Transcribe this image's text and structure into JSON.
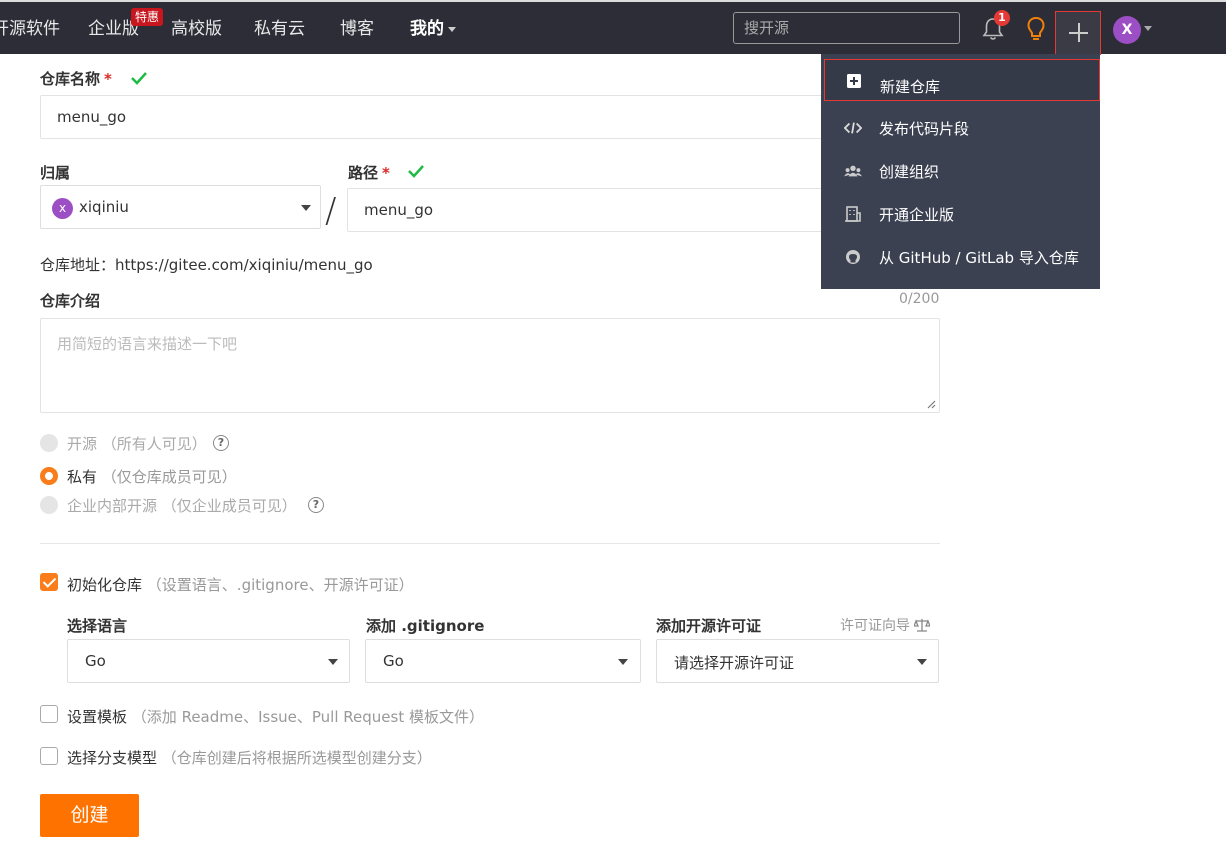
{
  "nav": {
    "items": [
      {
        "label": "开源软件"
      },
      {
        "label": "企业版"
      },
      {
        "label": "高校版"
      },
      {
        "label": "私有云"
      },
      {
        "label": "博客"
      },
      {
        "label": "我的"
      }
    ],
    "hot_badge": "特惠",
    "search_placeholder": "搜开源",
    "notification_count": "1",
    "avatar_letter": "X"
  },
  "dropdown": {
    "items": [
      {
        "label": "新建仓库",
        "icon": "plus-square-icon"
      },
      {
        "label": "发布代码片段",
        "icon": "code-icon"
      },
      {
        "label": "创建组织",
        "icon": "users-icon"
      },
      {
        "label": "开通企业版",
        "icon": "building-icon"
      },
      {
        "label": "从 GitHub / GitLab 导入仓库",
        "icon": "github-icon"
      }
    ]
  },
  "form": {
    "repo_name_label": "仓库名称",
    "repo_name_value": "menu_go",
    "owner_label": "归属",
    "owner_value": "xiqiniu",
    "owner_avatar": "x",
    "path_label": "路径",
    "path_value": "menu_go",
    "required_mark": "*",
    "slash": "/",
    "repo_url": "仓库地址：https://gitee.com/xiqiniu/menu_go",
    "desc_label": "仓库介绍",
    "desc_counter": "0/200",
    "desc_placeholder": "用简短的语言来描述一下吧",
    "visibility": [
      {
        "label": "开源",
        "hint": "（所有人可见）",
        "selected": false,
        "disabled": true
      },
      {
        "label": "私有",
        "hint": "（仅仓库成员可见）",
        "selected": true,
        "disabled": false
      },
      {
        "label": "企业内部开源",
        "hint": "（仅企业成员可见）",
        "selected": false,
        "disabled": true
      }
    ],
    "init_repo": {
      "label": "初始化仓库",
      "hint": "（设置语言、.gitignore、开源许可证）",
      "checked": true
    },
    "language": {
      "label": "选择语言",
      "value": "Go"
    },
    "gitignore": {
      "label": "添加 .gitignore",
      "value": "Go"
    },
    "license": {
      "label": "添加开源许可证",
      "value": "请选择开源许可证",
      "guide": "许可证向导"
    },
    "template": {
      "label": "设置模板",
      "hint": "（添加 Readme、Issue、Pull Request 模板文件）",
      "checked": false
    },
    "branch_model": {
      "label": "选择分支模型",
      "hint": "（仓库创建后将根据所选模型创建分支）",
      "checked": false
    },
    "create_button": "创建"
  },
  "colors": {
    "nav_bg": "#2d2d37",
    "accent": "#fe7300",
    "dropdown_bg": "#3b4151",
    "success": "#21ba45",
    "danger": "#db2828"
  }
}
